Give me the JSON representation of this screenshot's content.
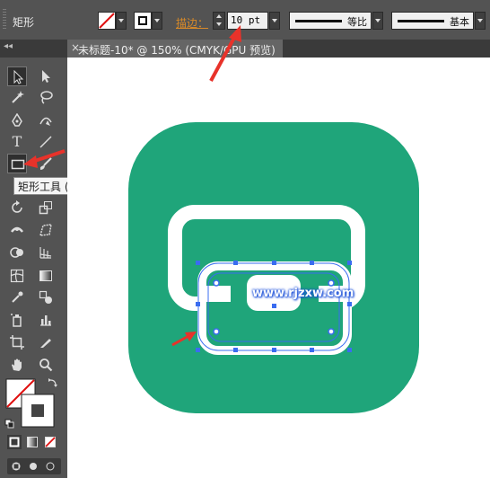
{
  "control_bar": {
    "tool_name": "矩形",
    "stroke_label": "描边：",
    "stroke_value": "10 pt",
    "variable_width_profile": "等比",
    "brush_definition": "基本",
    "fill_icon": "none-swatch-icon",
    "stroke_icon": "stroke-swatch-icon"
  },
  "document_tab": {
    "close_glyph": "×",
    "title": "未标题-10* @ 150% (CMYK/GPU 预览)"
  },
  "toolbox": {
    "collapse_glyph": "◂◂",
    "tooltip": "矩形工具 (M)",
    "type_tool": "T"
  },
  "canvas": {
    "watermark": "www.rjzxw.com",
    "icon_color": "#1fa57a",
    "selection_color": "#3a6cf0"
  },
  "annotations": {
    "arrow_color": "#e8322a"
  }
}
